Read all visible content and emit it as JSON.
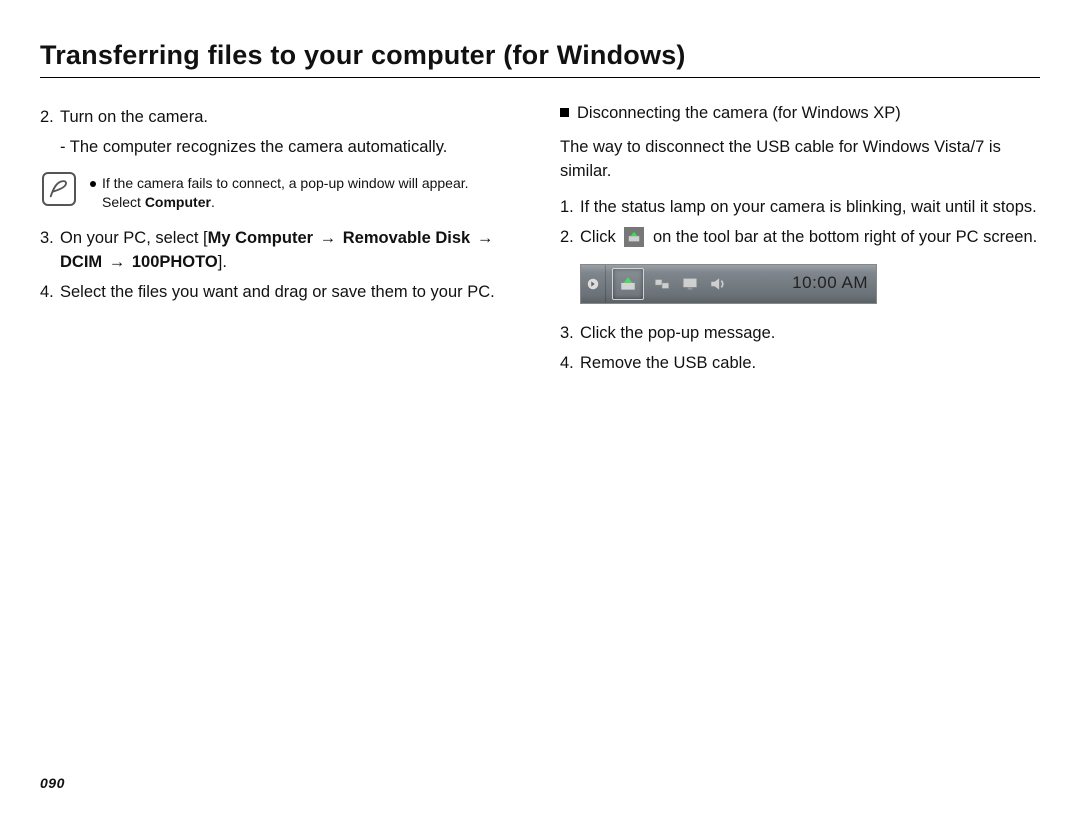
{
  "title": "Transferring files to your computer (for Windows)",
  "page_number": "090",
  "left": {
    "step2_num": "2.",
    "step2_text": "Turn on the camera.",
    "step2_sub_dash": "-",
    "step2_sub_text": "The computer recognizes the camera automatically.",
    "note_line1": "If the camera fails to connect, a pop-up window will appear.",
    "note_line2_pre": "Select ",
    "note_line2_bold": "Computer",
    "note_line2_post": ".",
    "step3_num": "3.",
    "step3_pre": "On your PC, select [",
    "step3_b1": "My Computer",
    "step3_b2": "Removable Disk",
    "step3_b3": "DCIM",
    "step3_b4": "100PHOTO",
    "step3_post": "].",
    "arrow": "→",
    "step4_num": "4.",
    "step4_text": "Select the files you want and drag or save them to your PC."
  },
  "right": {
    "sub_title": "Disconnecting the camera (for Windows XP)",
    "intro": "The way to disconnect the USB cable for Windows Vista/7 is similar.",
    "s1_num": "1.",
    "s1_text": "If the status lamp on your camera is blinking, wait until it stops.",
    "s2_num": "2.",
    "s2_pre": "Click",
    "s2_post": "on the tool bar at the bottom right of your PC screen.",
    "taskbar_time": "10:00 AM",
    "s3_num": "3.",
    "s3_text": "Click the pop-up message.",
    "s4_num": "4.",
    "s4_text": "Remove the USB cable."
  }
}
